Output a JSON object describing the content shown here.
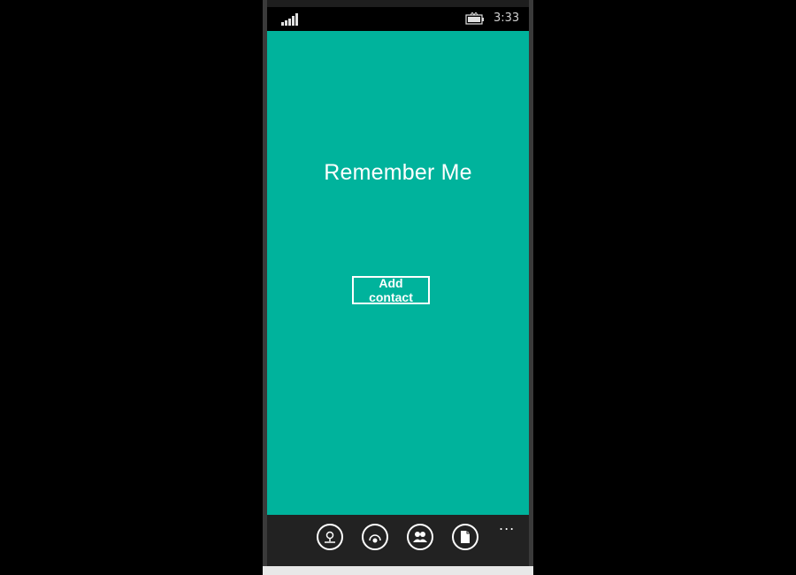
{
  "status_bar": {
    "time": "3:33",
    "signal_icon": "signal-strength-icon",
    "battery_icon": "battery-icon"
  },
  "main": {
    "title": "Remember Me",
    "add_contact_label": "Add contact",
    "background_color": "#00b39c"
  },
  "app_bar": {
    "buttons": [
      {
        "icon": "map-pin-icon"
      },
      {
        "icon": "radar-icon"
      },
      {
        "icon": "people-icon"
      },
      {
        "icon": "document-icon"
      }
    ],
    "more_label": "..."
  }
}
